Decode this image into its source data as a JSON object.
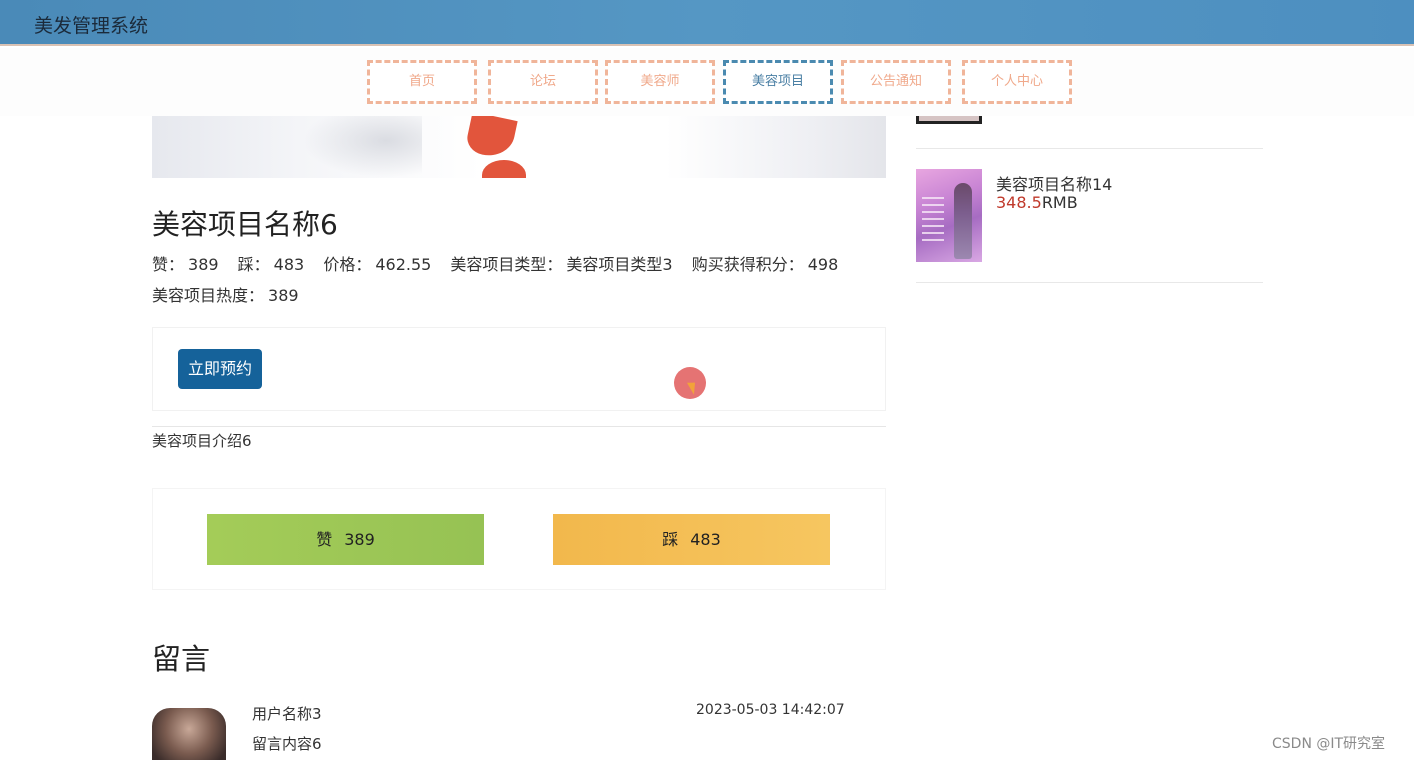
{
  "header": {
    "title": "美发管理系统"
  },
  "nav": {
    "items": [
      "首页",
      "论坛",
      "美容师",
      "美容项目",
      "公告通知",
      "个人中心"
    ],
    "active": "美容项目"
  },
  "item": {
    "title": "美容项目名称6",
    "like_label": "赞：",
    "like_count": "389",
    "dislike_label": "踩：",
    "dislike_count": "483",
    "price_label": "价格：",
    "price": "462.55",
    "type_label": "美容项目类型：",
    "type": "美容项目类型3",
    "points_label": "购买获得积分：",
    "points": "498",
    "heat_label": "美容项目热度：",
    "heat": "389",
    "book_button": "立即预约",
    "intro": "美容项目介绍6"
  },
  "vote": {
    "like_label": "赞",
    "like_count": "389",
    "dislike_label": "踩",
    "dislike_count": "483"
  },
  "messages": {
    "heading": "留言",
    "items": [
      {
        "user": "用户名称3",
        "content": "留言内容6",
        "time": "2023-05-03 14:42:07"
      }
    ]
  },
  "sidebar": {
    "items": [
      {
        "name": "美容项目名称14",
        "price": "348.5",
        "unit": "RMB"
      }
    ]
  },
  "watermark": "CSDN @IT研究室",
  "colors": {
    "header_bg": "#4a8ab8",
    "nav_border": "#f0b59a",
    "nav_active_border": "#4a8ab0",
    "book_button": "#15629a",
    "like_button": "#9ac656",
    "dislike_button": "#f4bf55",
    "price_accent": "#c0392b"
  }
}
